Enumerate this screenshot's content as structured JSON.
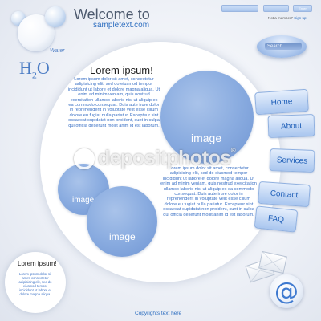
{
  "header": {
    "welcome": "Welcome to",
    "site": "sampletext.com",
    "top_button_label": "Enter",
    "member_text": "Not a member?",
    "signup": "Sign up!"
  },
  "search": {
    "placeholder": "Search..."
  },
  "logo": {
    "water": "Water",
    "h": "H",
    "sub": "2",
    "o": "O"
  },
  "main": {
    "title": "Lorem ipsum!",
    "body": "Lorem ipsum dolor sit amet, consectetur adipisicing elit, sed do eiusmod tempor incididunt ut labore et dolore magna aliqua. Ut enim ad minim veniam, quis nostrud exercitation ullamco laboris nisi ut aliquip ex ea commodo consequat. Duis aute irure dolor in reprehenderit in voluptate velit esse cillum dolore eu fugiat nulla pariatur. Excepteur sint occaecat cupidatat non proident, sunt in culpa qui officia deserunt mollit anim id est laborum.",
    "body_right": "Lorem ipsum dolor sit amet, consectetur adipisicing elit, sed do eiusmod tempor incididunt ut labore et dolore magna aliqua. Ut enim ad minim veniam, quis nostrud exercitation ullamco laboris nisi ut aliquip ex ea commodo consequat. Duis aute irure dolor in reprehenderit in voluptate velit esse cillum dolore eu fugiat nulla pariatur. Excepteur sint occaecat cupidatat non proident, sunt in culpa qui officia deserunt mollit anim id est laborum.",
    "image_label": "image"
  },
  "nav": [
    "Home",
    "About",
    "Services",
    "Contact",
    "FAQ"
  ],
  "sidebar_box": {
    "title": "Lorem ipsum!",
    "body": "Lorem ipsum dolor sit amet, consectetur adipisicing elit, sed do eiusmod tempor incididunt ut labore et dolore magna aliqua."
  },
  "icons": {
    "mail": "envelope-icon",
    "at": "at-sign-icon",
    "at_glyph": "@"
  },
  "footer": {
    "copyright": "Copyrights text here"
  },
  "watermark": {
    "text": "depositphotos",
    "reg": "®"
  },
  "colors": {
    "accent": "#2f6fc0",
    "button": "#a9c6ef",
    "image": "#8aace0"
  }
}
